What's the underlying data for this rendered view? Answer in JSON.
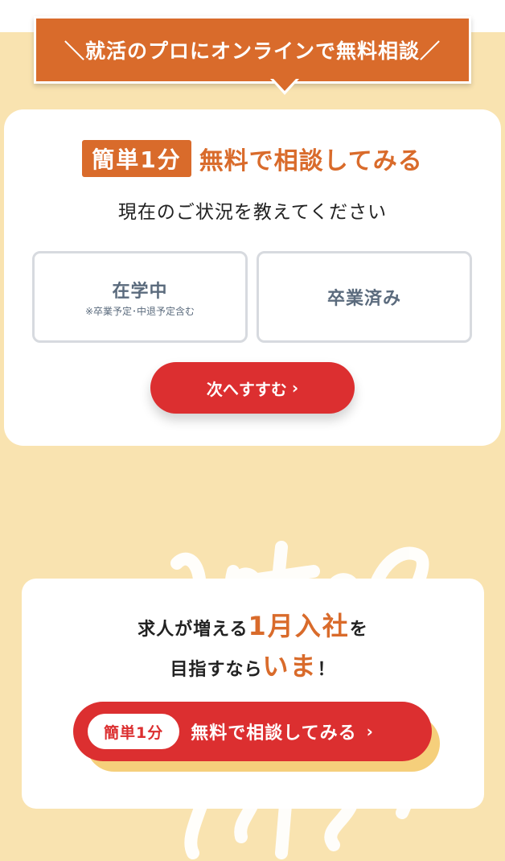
{
  "ribbon": {
    "text": "＼就活のプロにオンラインで無料相談／"
  },
  "form_card": {
    "badge": "簡単1分",
    "heading": "無料で相談してみる",
    "question": "現在のご状況を教えてください",
    "options": [
      {
        "label": "在学中",
        "note": "※卒業予定･中退予定含む"
      },
      {
        "label": "卒業済み",
        "note": ""
      }
    ],
    "next_button": "次へすすむ",
    "next_icon": "chevron-right"
  },
  "cta_card": {
    "line1_pre": "求人が増える",
    "line1_highlight": "1月入社",
    "line1_post": "を",
    "line2_pre": "目指すなら",
    "line2_highlight": "いま",
    "line2_post": "！",
    "button_badge": "簡単1分",
    "button_text": "無料で相談してみる",
    "button_icon": "chevron-right"
  },
  "colors": {
    "accent_orange": "#d96b2b",
    "button_red": "#dc2f30",
    "cream_bg": "#f9e3b0",
    "option_text": "#5b6b7d"
  }
}
